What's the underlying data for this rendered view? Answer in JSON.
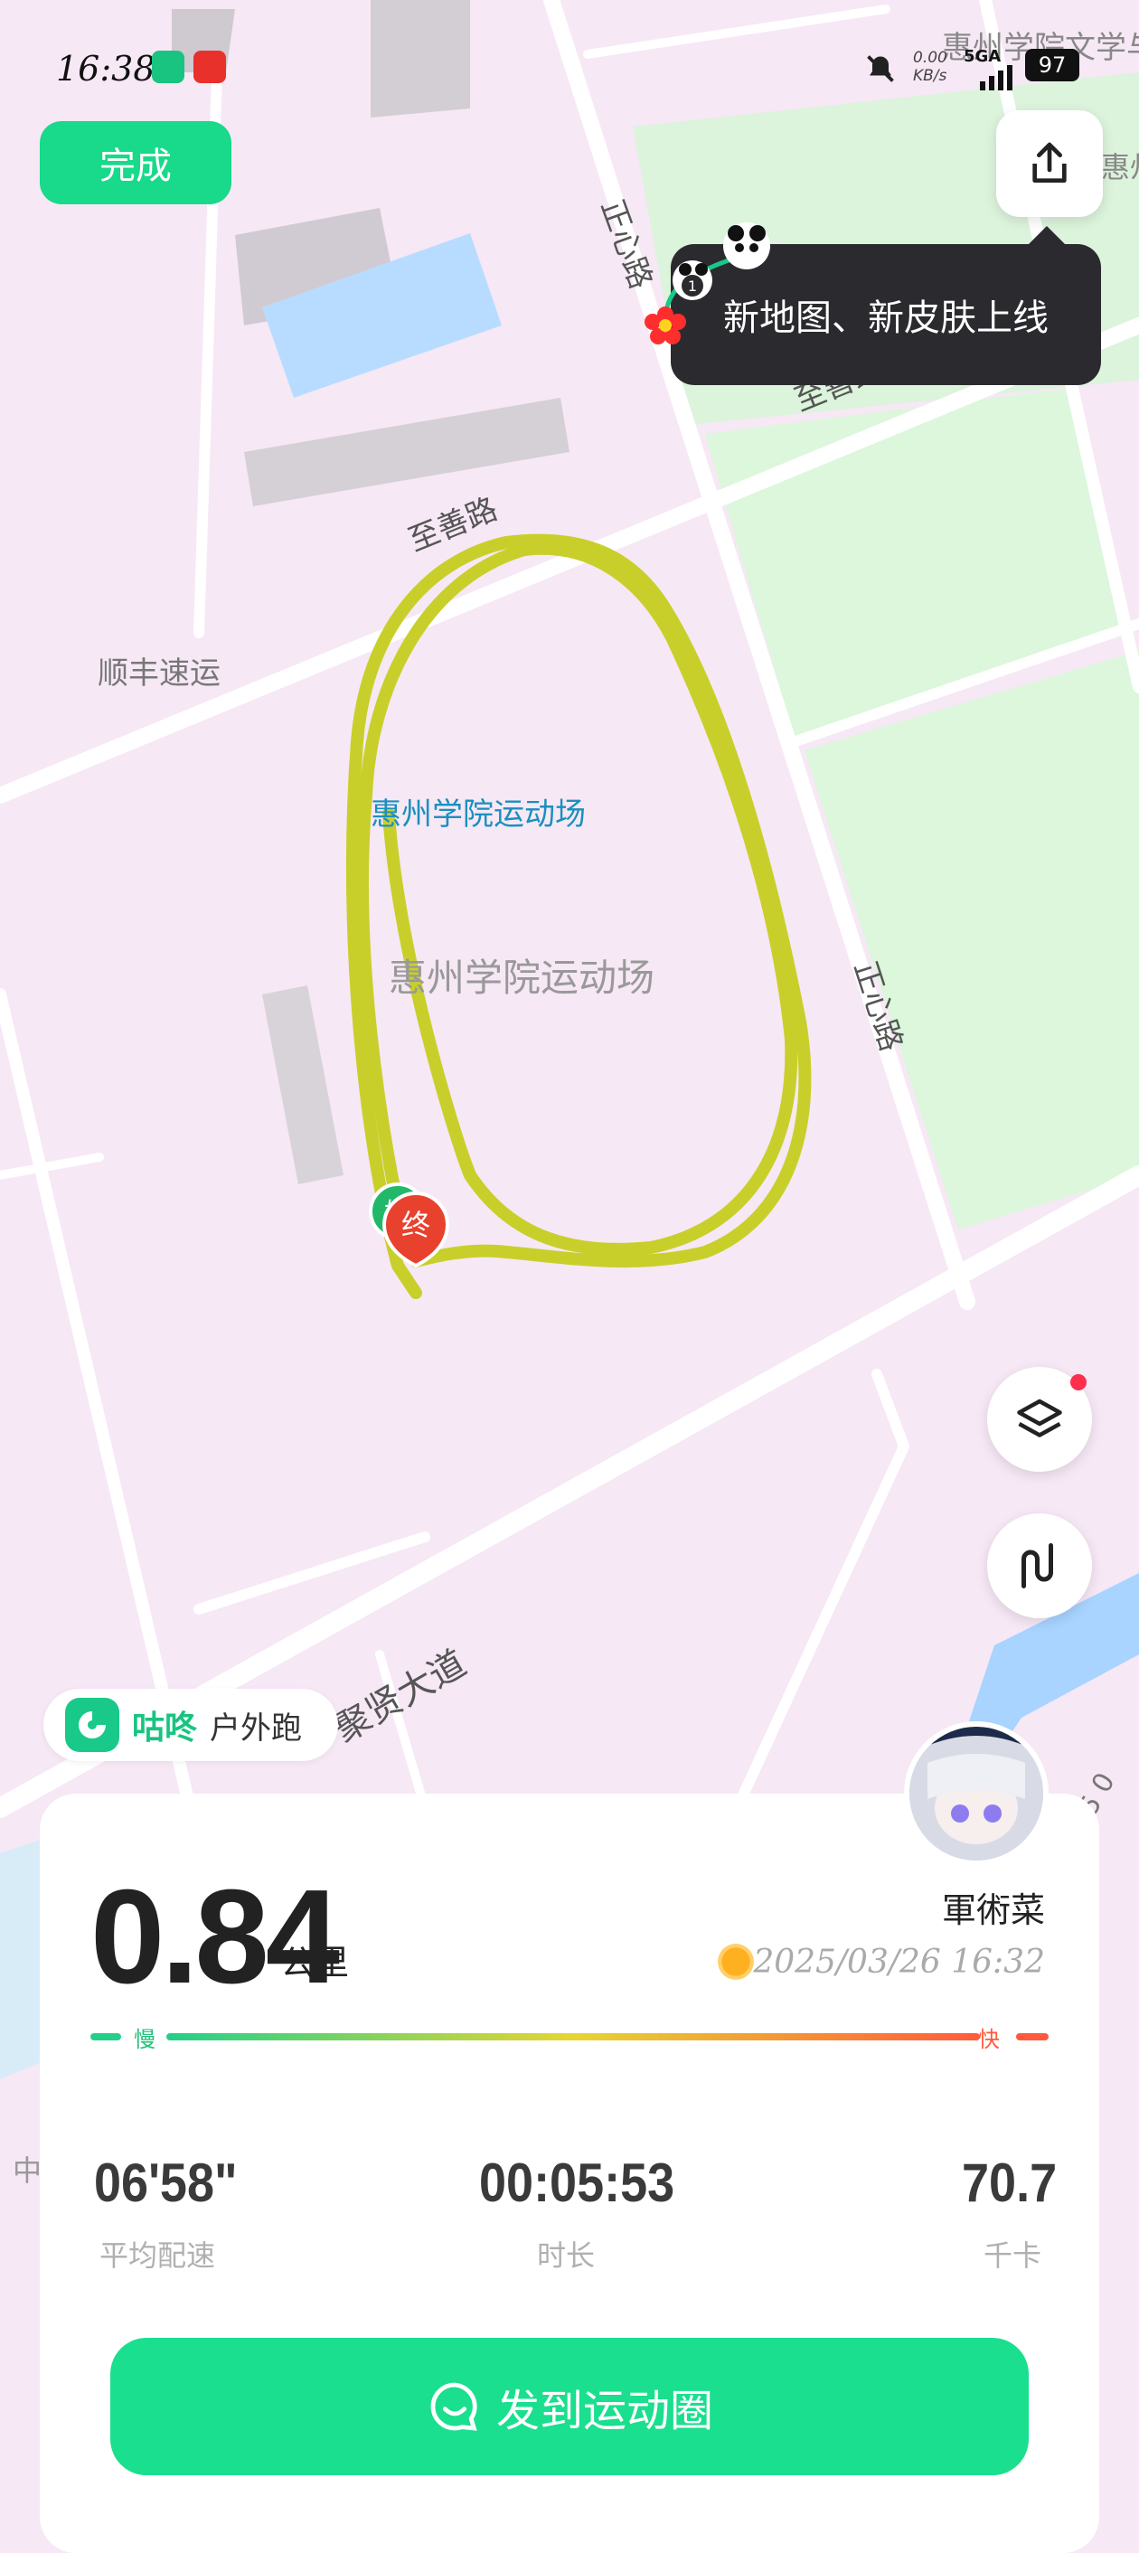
{
  "status_bar": {
    "time": "16:38",
    "net_speed": "0.00",
    "net_unit": "KB/s",
    "network": "5GA",
    "battery": "97"
  },
  "header": {
    "done_label": "完成"
  },
  "tooltip": {
    "text": "新地图、新皮肤上线",
    "badge_number": "1"
  },
  "map": {
    "labels": {
      "road_zhengxin_top": "正心路",
      "road_zhishan_top": "至善路",
      "road_zhishan": "至善路",
      "shunfeng": "顺丰速运",
      "stadium_blue": "惠州学院运动场",
      "stadium_gray": "惠州学院运动场",
      "road_zhengxin": "正心路",
      "road_juxian": "聚贤大道",
      "college_top": "惠州学院文学与传媒学院",
      "corner_right": "惠州-外",
      "edge_left": "中",
      "edge_right": "5 0"
    },
    "start_marker": "始",
    "end_marker": "终"
  },
  "brand": {
    "name": "咕咚",
    "sub": "户外跑"
  },
  "summary": {
    "distance": "0.84",
    "distance_unit": "公里",
    "username": "軍術菜",
    "datetime": "2025/03/26 16:32",
    "slow_label": "慢",
    "fast_label": "快",
    "stats": [
      {
        "value": "06'58\"",
        "label": "平均配速"
      },
      {
        "value": "00:05:53",
        "label": "时长"
      },
      {
        "value": "70.7",
        "label": "千卡"
      }
    ]
  },
  "post_button": {
    "label": "发到运动圈"
  },
  "colors": {
    "accent": "#19df8e",
    "route": "#c9cf2a",
    "tooltip_bg": "#2b2b2f",
    "marker_end": "#e8412e"
  }
}
